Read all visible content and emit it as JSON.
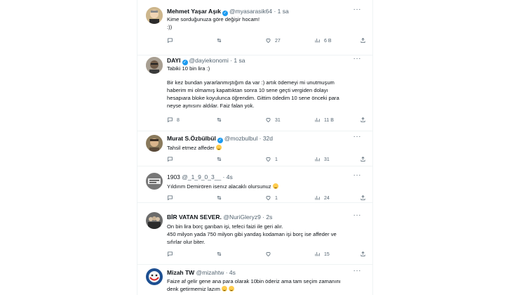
{
  "tweets": [
    {
      "name": "Mehmet Yaşar Aşık",
      "handle": "@myasarasik64 · 1 sa",
      "lines": [
        "Kime sorduğunuza göre değişir hocam!",
        ":))"
      ],
      "replies": "",
      "retweets": "",
      "likes": "27",
      "views": "6 B"
    },
    {
      "name": "DAYI",
      "handle": "@dayiekonomi · 1 sa",
      "lines": [
        "Tabiki 10 bin lira :)",
        "",
        "Bir kez bundan yararlanmıştığım da var :) artık ödemeyi mi unutmuşum",
        "haberim mi olmamış kapattıktan sonra 10 sene geçti vergiden dolayı",
        "hesapıara bloke koyulunca öğrendim. Gittim ödedim 10 sene önceki para",
        "neyse aynısını aldılar. Faiz falan yok."
      ],
      "replies": "8",
      "retweets": "",
      "likes": "31",
      "views": "11 B"
    },
    {
      "name": "Murat S.Özbülbül",
      "handle": "@mozbulbul · 32d",
      "lines": [
        "Tahsil etmez affeder"
      ],
      "replies": "",
      "retweets": "",
      "likes": "1",
      "views": "31"
    },
    {
      "name": "1903",
      "handle": "@_1_9_0_3__ · 4s",
      "lines": [
        "Yıldırım Demirören isenız alacaklı olursunuz"
      ],
      "replies": "",
      "retweets": "",
      "likes": "1",
      "views": "24"
    },
    {
      "name": "BİR VATAN SEVER.",
      "handle": "@NuriGleryz9 · 2s",
      "lines": [
        "On bin lira borç garıban işi, tefeci faizi ile geri alır.",
        "450 milyon yada 750 milyon gibi yandaş kodaman işi borç ise affeder ve",
        "sıfırlar olur biter."
      ],
      "replies": "",
      "retweets": "",
      "likes": "",
      "views": "15"
    },
    {
      "name": "Mizah TW",
      "handle": "@mizahtw · 4s",
      "lines": [
        "Faize af gelir gene ana para olarak 10bin öderiz ama tam seçim zamanını",
        "denk getirmemiz lazım"
      ],
      "replies": "",
      "retweets": "",
      "likes": "",
      "views": ""
    }
  ],
  "icons": {
    "reply": "reply-icon",
    "retweet": "retweet-icon",
    "like": "heart-icon",
    "views": "views-icon",
    "share": "share-icon",
    "more": "more-icon",
    "verified": "verified-badge-icon"
  },
  "colors": {
    "verified": "#1d9bf0",
    "muted": "#536471",
    "divider": "#eff3f4"
  }
}
